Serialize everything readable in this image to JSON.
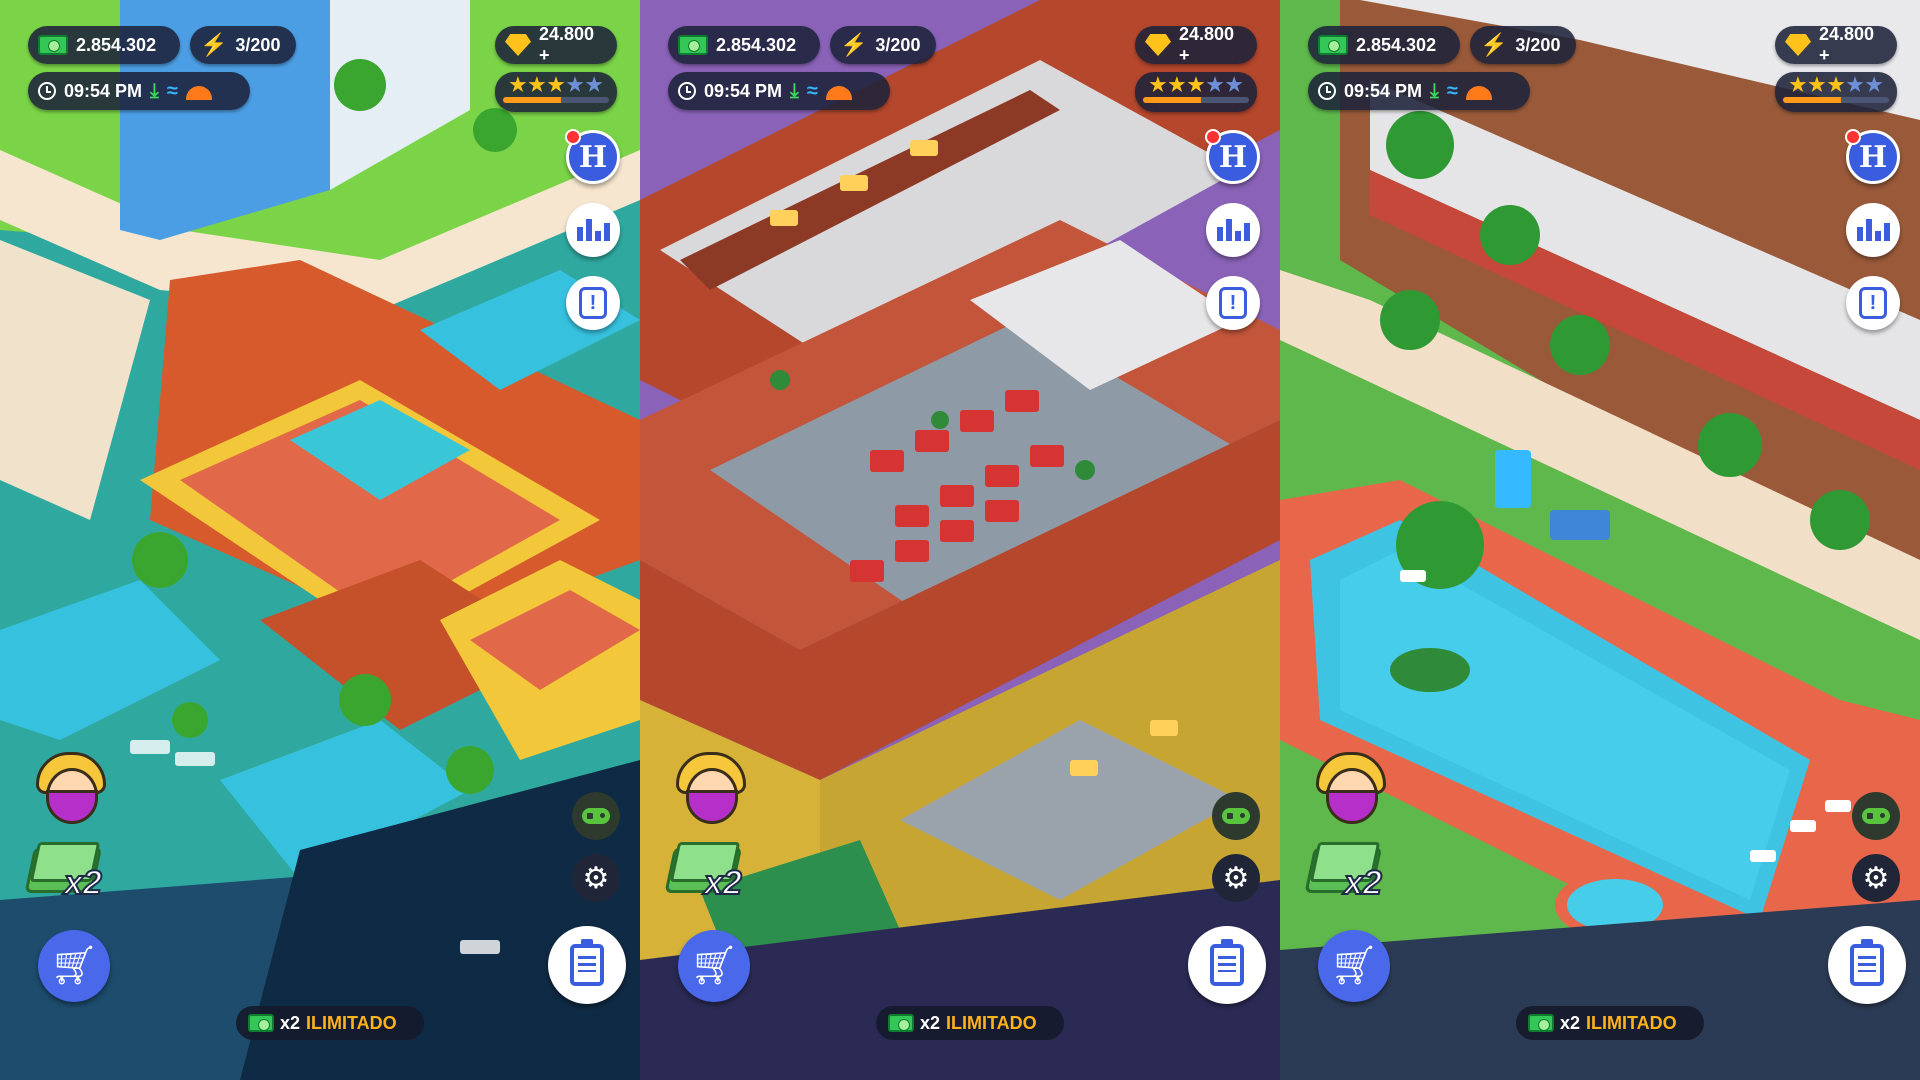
{
  "hud": {
    "cash": "2.854.302",
    "energy": "3/200",
    "time": "09:54 PM",
    "gems": "24.800 +",
    "rating_stars": 3,
    "rating_max": 5,
    "rating_progress": 0.55
  },
  "buttons": {
    "hotel_label": "H",
    "boost_label": "x2",
    "promo_multiplier": "x2",
    "promo_text": "ILIMITADO"
  },
  "icons": {
    "cash": "cash-icon",
    "energy": "lightning-icon",
    "clock": "clock-icon",
    "gem": "gem-icon",
    "cart": "shopping-cart-icon",
    "settings": "gear-icon",
    "tasks": "clipboard-icon",
    "stats": "bar-chart-icon",
    "alert": "exclamation-icon",
    "gamepad": "gamepad-icon"
  },
  "colors": {
    "hud_bg": "#1c223a",
    "accent_blue": "#3a5de0",
    "cash_green": "#35c658",
    "gold": "#ffc21a",
    "energy_orange": "#ffb21a"
  },
  "panels": [
    {
      "scene": "villa-pool-scene"
    },
    {
      "scene": "restaurant-rooms-scene"
    },
    {
      "scene": "outdoor-pool-scene"
    }
  ]
}
